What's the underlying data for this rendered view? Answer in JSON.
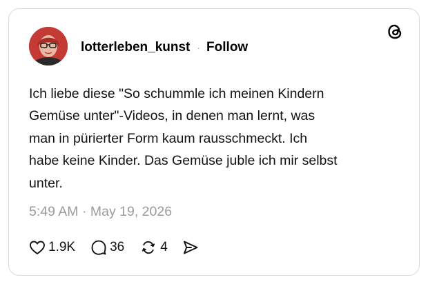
{
  "post": {
    "username": "lotterleben_kunst",
    "separator": "·",
    "follow_label": "Follow",
    "text_lines": [
      "Ich liebe diese \"So schummle ich meinen Kindern",
      "Gemüse unter\"-Videos, in denen man lernt, was",
      "man in pürierter Form kaum rausschmeckt. Ich",
      "habe keine Kinder. Das Gemüse juble ich mir selbst",
      "unter."
    ],
    "timestamp": "5:49 AM · May 19, 2026"
  },
  "actions": {
    "likes": "1.9K",
    "comments": "36",
    "reposts": "4"
  },
  "icons": {
    "brand": "threads-logo-icon",
    "like": "heart-icon",
    "comment": "comment-bubble-icon",
    "repost": "repost-icon",
    "share": "send-icon"
  },
  "colors": {
    "text": "#111111",
    "muted": "#9b9b9b",
    "border": "#d9d9d9",
    "avatar_hair": "#c33b34"
  }
}
